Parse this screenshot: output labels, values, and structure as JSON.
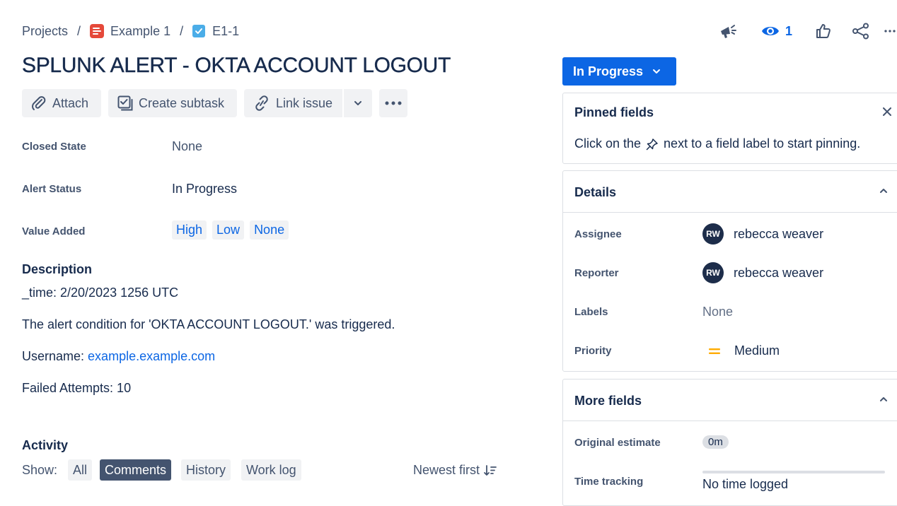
{
  "breadcrumb": {
    "projects": "Projects",
    "separator": "/",
    "project": "Example 1",
    "issue_key": "E1-1"
  },
  "header_actions": {
    "watch_count": "1"
  },
  "issue": {
    "title": "SPLUNK ALERT - OKTA ACCOUNT LOGOUT"
  },
  "toolbar": {
    "attach": "Attach",
    "create_subtask": "Create subtask",
    "link_issue": "Link issue"
  },
  "fields": {
    "closed_state": {
      "label": "Closed State",
      "value": "None"
    },
    "alert_status": {
      "label": "Alert Status",
      "value": "In Progress"
    },
    "value_added": {
      "label": "Value Added",
      "options": [
        "High",
        "Low",
        "None"
      ]
    }
  },
  "description": {
    "heading": "Description",
    "time_line": "_time: 2/20/2023 1256 UTC",
    "condition_line": "The alert condition for 'OKTA ACCOUNT LOGOUT.' was triggered.",
    "username_label": "Username: ",
    "username_link": "example.example.com",
    "failed_attempts": "Failed Attempts: 10"
  },
  "activity": {
    "heading": "Activity",
    "show_label": "Show:",
    "filters": [
      "All",
      "Comments",
      "History",
      "Work log"
    ],
    "selected_filter": "Comments",
    "sort": "Newest first"
  },
  "status": {
    "label": "In Progress"
  },
  "pinned": {
    "heading": "Pinned fields",
    "hint_before": "Click on the",
    "hint_after": "next to a field label to start pinning."
  },
  "details": {
    "heading": "Details",
    "assignee": {
      "label": "Assignee",
      "initials": "RW",
      "name": "rebecca weaver"
    },
    "reporter": {
      "label": "Reporter",
      "initials": "RW",
      "name": "rebecca weaver"
    },
    "labels": {
      "label": "Labels",
      "value": "None"
    },
    "priority": {
      "label": "Priority",
      "value": "Medium"
    }
  },
  "more_fields": {
    "heading": "More fields",
    "original_estimate": {
      "label": "Original estimate",
      "value": "0m"
    },
    "time_tracking": {
      "label": "Time tracking",
      "value": "No time logged"
    }
  },
  "colors": {
    "brand_blue": "#0c66e4",
    "text": "#172b4d",
    "subtle": "#44546f",
    "priority_medium": "#ffab00"
  }
}
